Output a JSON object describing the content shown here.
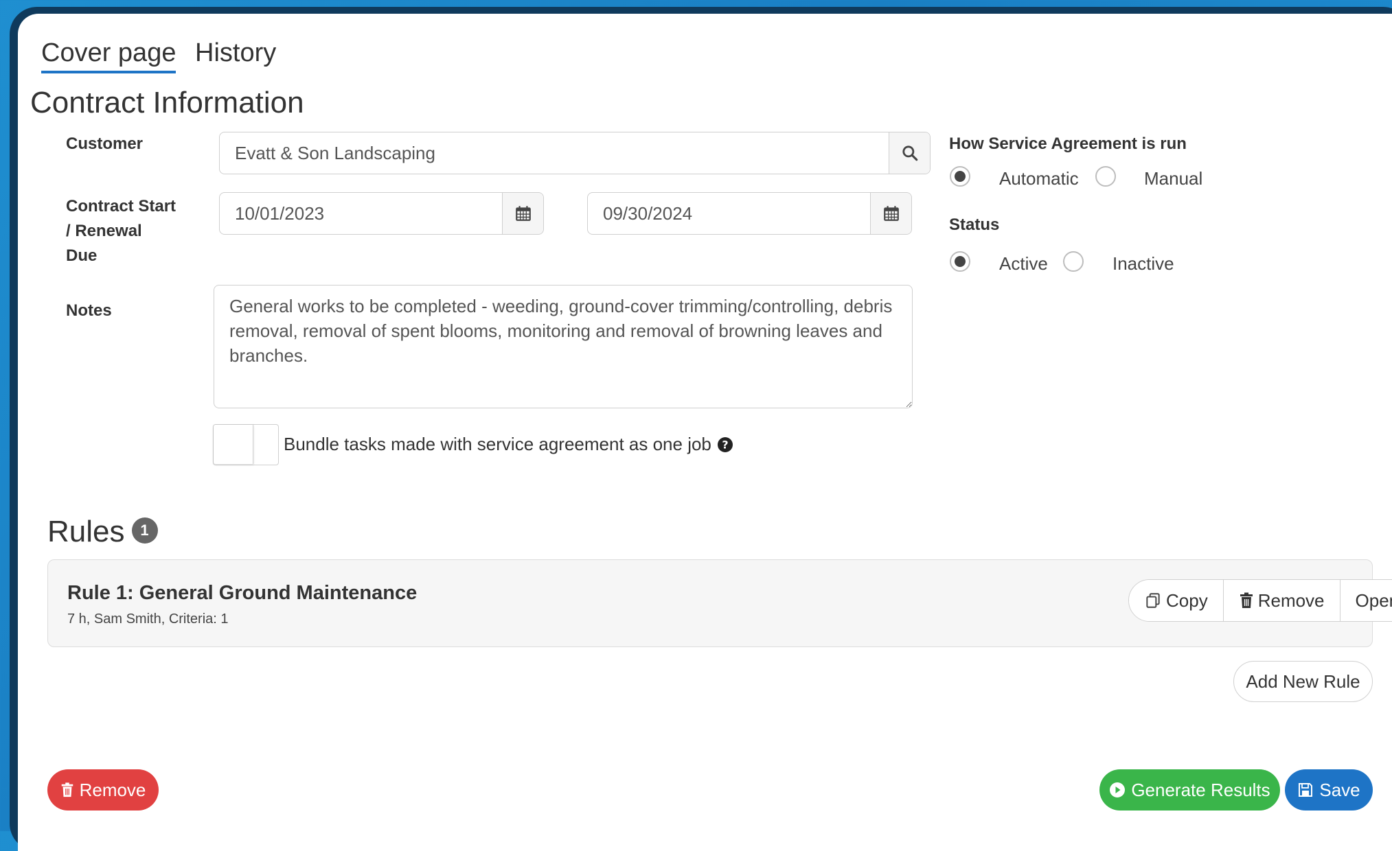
{
  "tabs": [
    {
      "label": "Cover page",
      "active": true
    },
    {
      "label": "History",
      "active": false
    }
  ],
  "section_title": "Contract Information",
  "customer": {
    "label": "Customer",
    "value": "Evatt & Son Landscaping"
  },
  "contract": {
    "label_line1": "Contract Start",
    "label_line2": "/ Renewal",
    "label_line3": "Due",
    "start_date": "10/01/2023",
    "renewal_date": "09/30/2024"
  },
  "notes": {
    "label": "Notes",
    "value": "General works to be completed - weeding, ground-cover trimming/controlling, debris removal, removal of spent blooms, monitoring and removal of browning leaves and branches."
  },
  "bundle": {
    "label": "Bundle tasks made with service agreement as one job",
    "enabled": false
  },
  "run_mode": {
    "label": "How Service Agreement is run",
    "options": [
      "Automatic",
      "Manual"
    ],
    "selected": "Automatic"
  },
  "status": {
    "label": "Status",
    "options": [
      "Active",
      "Inactive"
    ],
    "selected": "Active"
  },
  "rules": {
    "title": "Rules",
    "count": "1",
    "items": [
      {
        "title": "Rule 1: General Ground Maintenance",
        "subtitle": "7 h, Sam Smith, Criteria: 1"
      }
    ],
    "copy_label": "Copy",
    "remove_label": "Remove",
    "open_label": "Open",
    "add_label": "Add New Rule"
  },
  "footer": {
    "remove_label": "Remove",
    "generate_label": "Generate Results",
    "save_label": "Save"
  },
  "colors": {
    "accent": "#1e74c6",
    "danger": "#e14141",
    "success": "#3ab54a"
  }
}
